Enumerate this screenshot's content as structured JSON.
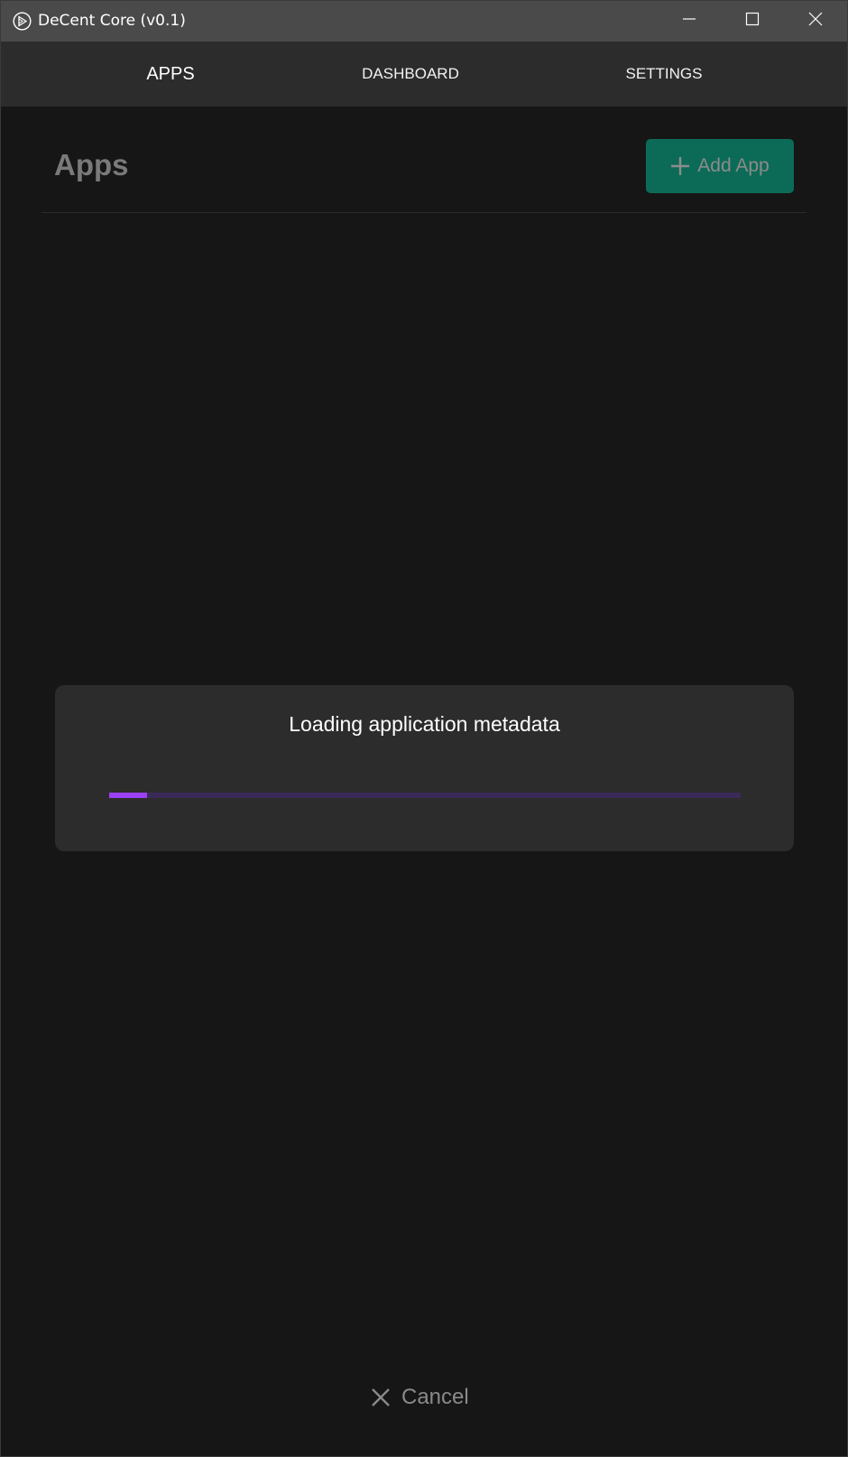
{
  "window": {
    "title": "DeCent Core (v0.1)"
  },
  "nav": {
    "tabs": [
      {
        "label": "APPS",
        "active": true
      },
      {
        "label": "DASHBOARD",
        "active": false
      },
      {
        "label": "SETTINGS",
        "active": false
      }
    ]
  },
  "header": {
    "title": "Apps",
    "add_button_label": "Add App"
  },
  "loading": {
    "message": "Loading application metadata",
    "progress_fraction": 0.06
  },
  "footer": {
    "cancel_label": "Cancel"
  },
  "colors": {
    "accent_green": "#0c6b56",
    "progress_fill": "#9b40f5",
    "progress_track": "#3b2a59"
  },
  "icons": {
    "app": "app-logo-icon",
    "minimize": "minimize-icon",
    "maximize": "maximize-icon",
    "close": "close-icon",
    "add": "plus-icon",
    "cancel": "x-icon"
  }
}
